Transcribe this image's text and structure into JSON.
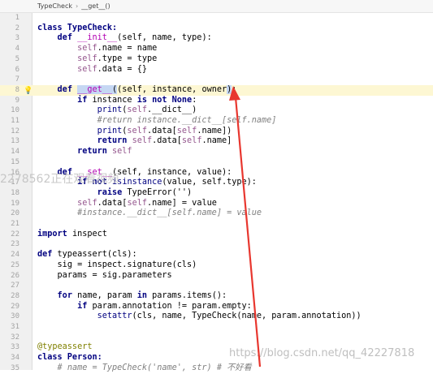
{
  "breadcrumb": {
    "items": [
      "TypeCheck",
      "__get__()"
    ]
  },
  "lines": [
    {
      "n": "1"
    },
    {
      "n": "2"
    },
    {
      "n": "3"
    },
    {
      "n": "4"
    },
    {
      "n": "5"
    },
    {
      "n": "6"
    },
    {
      "n": "7"
    },
    {
      "n": "8"
    },
    {
      "n": "9"
    },
    {
      "n": "10"
    },
    {
      "n": "11"
    },
    {
      "n": "12"
    },
    {
      "n": "13"
    },
    {
      "n": "14"
    },
    {
      "n": "15"
    },
    {
      "n": "16"
    },
    {
      "n": "17"
    },
    {
      "n": "18"
    },
    {
      "n": "19"
    },
    {
      "n": "20"
    },
    {
      "n": "21"
    },
    {
      "n": "22"
    },
    {
      "n": "23"
    },
    {
      "n": "24"
    },
    {
      "n": "25"
    },
    {
      "n": "26"
    },
    {
      "n": "27"
    },
    {
      "n": "28"
    },
    {
      "n": "29"
    },
    {
      "n": "30"
    },
    {
      "n": "31"
    },
    {
      "n": "32"
    },
    {
      "n": "33"
    },
    {
      "n": "34"
    },
    {
      "n": "35"
    }
  ],
  "code": {
    "l2": "class TypeCheck:",
    "l3": {
      "def": "def",
      "name": "__init__",
      "rest": "(self, name, type):"
    },
    "l4": {
      "self": "self",
      "rest": ".name = name"
    },
    "l5": {
      "self": "self",
      "rest": ".type = type"
    },
    "l6": {
      "self": "self",
      "rest": ".data = {}"
    },
    "l8": {
      "def": "def",
      "name": "__get__",
      "rest1": "(self, instance, ",
      "owner": "owner",
      "rest2": "):"
    },
    "l9": {
      "if": "if",
      "a": " instance ",
      "is": "is not",
      "none": " None",
      "colon": ":"
    },
    "l10": {
      "print": "print",
      "a": "(",
      "self": "self",
      "b": ".__dict__)"
    },
    "l11": "#return instance.__dict__[self.name]",
    "l12": {
      "print": "print",
      "a": "(",
      "self": "self",
      "b": ".data[",
      "self2": "self",
      "c": ".name])"
    },
    "l13": {
      "return": "return",
      "self": "self",
      "a": ".data[",
      "self2": "self",
      "b": ".name]"
    },
    "l14": {
      "return": "return",
      "self": "self"
    },
    "l16": {
      "def": "def",
      "name": "__set__",
      "rest": "(self, instance, value):"
    },
    "l17": {
      "if": "if",
      "not": "not",
      "isinstance": "isinstance",
      "rest": "(value, self.type):"
    },
    "l18": {
      "raise": "raise",
      "rest": "TypeError('')"
    },
    "l19": {
      "self": "self",
      "a": ".data[",
      "self2": "self",
      "b": ".name] = value"
    },
    "l20": "#instance.__dict__[self.name] = value",
    "l22": {
      "import": "import",
      "rest": " inspect"
    },
    "l24": {
      "def": "def",
      "rest": " typeassert(cls):"
    },
    "l25": "sig = inspect.signature(cls)",
    "l26": "params = sig.parameters",
    "l28": {
      "for": "for",
      "a": " name, param ",
      "in": "in",
      "b": " params.items():"
    },
    "l29": {
      "if": "if",
      "rest": " param.annotation != param.empty:"
    },
    "l30": {
      "setattr": "setattr",
      "rest": "(cls, name, TypeCheck(name, param.annotation))"
    },
    "l33": "@typeassert",
    "l34": "class Person:",
    "l35": {
      "comment": "# name = TypeCheck('name', str) # 不好看"
    }
  },
  "watermarks": {
    "left": "2278562正在观看视频",
    "right": "https://blog.csdn.net/qq_42227818"
  },
  "colors": {
    "arrow": "#e8372f",
    "highlight": "#fdf7d3",
    "selection": "#c5d7f3"
  }
}
